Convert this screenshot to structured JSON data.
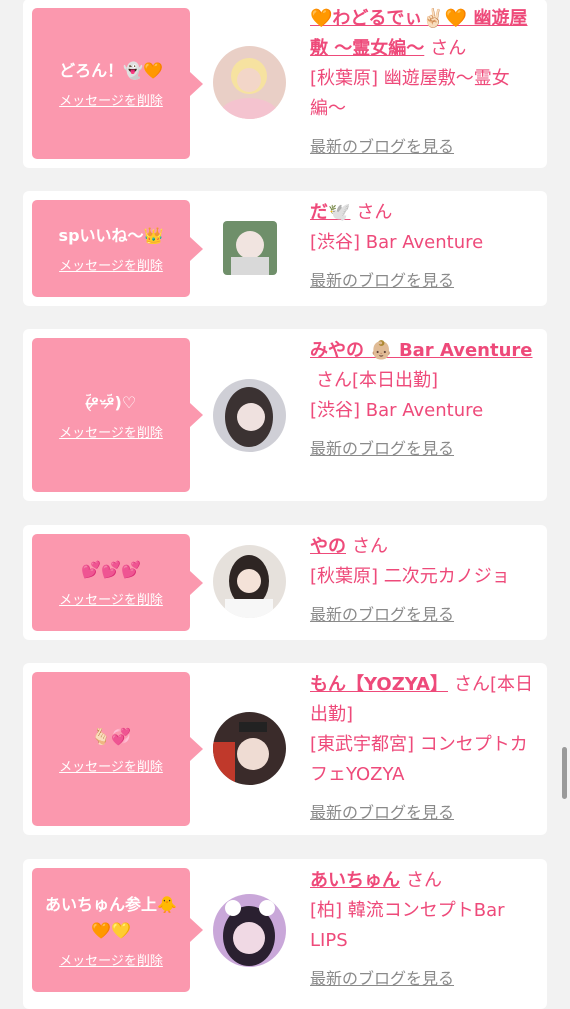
{
  "delete_label": "メッセージを削除",
  "blog_label": "最新のブログを見る",
  "san": "さん",
  "cards": [
    {
      "message": "どろん！👻🧡",
      "name": "🧡わどるでぃ✌🏻🧡 幽遊屋敷 〜霊女編〜",
      "extra": "",
      "shop": "[秋葉原] 幽遊屋敷〜霊女編〜"
    },
    {
      "message": "spいいね〜👑",
      "name": "だ🕊️",
      "extra": "",
      "shop": "[渋谷] Bar Aventure"
    },
    {
      "message": "(ؔᵒ̶̷ᵕؔᵒ̶̷)♡",
      "name": "みやの 👶🏼 Bar Aventure",
      "extra": "[本日出勤]",
      "shop": "[渋谷] Bar Aventure"
    },
    {
      "message": "💕💕💕",
      "name": "やの",
      "extra": "",
      "shop": "[秋葉原] 二次元カノジョ"
    },
    {
      "message": "🫰🏻💞",
      "name": "もん【YOZYA】",
      "extra": "[本日出勤]",
      "shop": "[東武宇都宮] コンセプトカフェYOZYA"
    },
    {
      "message": "あいちゅん参上🐥🧡💛",
      "name": "あいちゅん",
      "extra": "",
      "shop": "[柏] 韓流コンセプトBar LIPS"
    }
  ],
  "colors": {
    "accent": "#ee4a7a",
    "bubble": "#fb98ae",
    "link_gray": "#8a8a8a",
    "background": "#f2f2f2"
  }
}
